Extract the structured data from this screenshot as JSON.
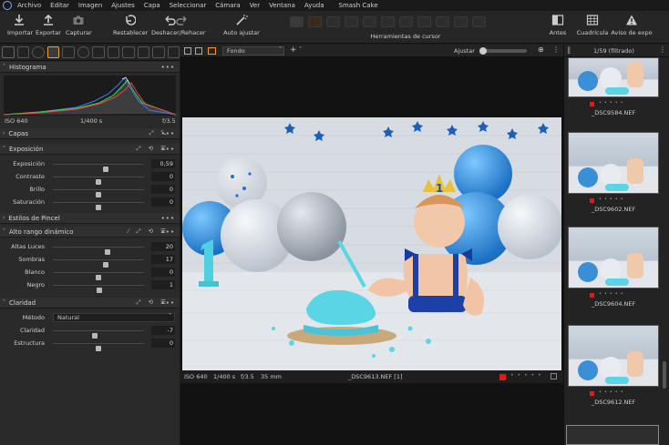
{
  "menubar": {
    "items": [
      "Archivo",
      "Editar",
      "Imagen",
      "Ajustes",
      "Capa",
      "Seleccionar",
      "Cámara",
      "Ver",
      "Ventana",
      "Ayuda"
    ],
    "title": "Smash Cake"
  },
  "toolbar": {
    "importar": "Importar",
    "exportar": "Exportar",
    "capturar": "Capturar",
    "restablecer": "Restablecer",
    "deshacer": "Deshacer/Rehacer",
    "auto": "Auto ajustar",
    "herramientas": "Herramientas de cursor",
    "antes": "Antes",
    "cuadricula": "Cuadrícula",
    "aviso": "Aviso de expo"
  },
  "histogram": {
    "title": "Histograma",
    "iso": "ISO 640",
    "shutter": "1/400 s",
    "aperture": "f/3.5"
  },
  "capas": {
    "title": "Capas"
  },
  "exposicion": {
    "title": "Exposición",
    "rows": [
      {
        "label": "Exposición",
        "value": "0,59",
        "pos": 0.58
      },
      {
        "label": "Contraste",
        "value": "0",
        "pos": 0.5
      },
      {
        "label": "Brillo",
        "value": "0",
        "pos": 0.5
      },
      {
        "label": "Saturación",
        "value": "0",
        "pos": 0.5
      }
    ]
  },
  "estilos": {
    "title": "Estilos de Pincel"
  },
  "hdr": {
    "title": "Alto rango dinámico",
    "rows": [
      {
        "label": "Altas Luces",
        "value": "20",
        "pos": 0.6
      },
      {
        "label": "Sombras",
        "value": "17",
        "pos": 0.58
      },
      {
        "label": "Blanco",
        "value": "0",
        "pos": 0.5
      },
      {
        "label": "Negro",
        "value": "1",
        "pos": 0.51
      }
    ]
  },
  "claridad": {
    "title": "Claridad",
    "metodo_label": "Método",
    "metodo_value": "Natural",
    "rows": [
      {
        "label": "Claridad",
        "value": "-7",
        "pos": 0.46
      },
      {
        "label": "Estructura",
        "value": "0",
        "pos": 0.5
      }
    ]
  },
  "viewer": {
    "background": "Fondo",
    "ajustar": "Ajustar",
    "iso": "ISO 640",
    "shutter": "1/400 s",
    "aperture": "f/3.5",
    "focal": "35 mm",
    "filename": "_DSC9613.NEF [1]"
  },
  "browser": {
    "count": "1/59 (filtrado)",
    "thumbs": [
      "_DSC9584.NEF",
      "_DSC9602.NEF",
      "_DSC9604.NEF",
      "_DSC9612.NEF"
    ]
  },
  "colors": {
    "flag": "#e01b1b",
    "accent": "#3a8fd6"
  }
}
